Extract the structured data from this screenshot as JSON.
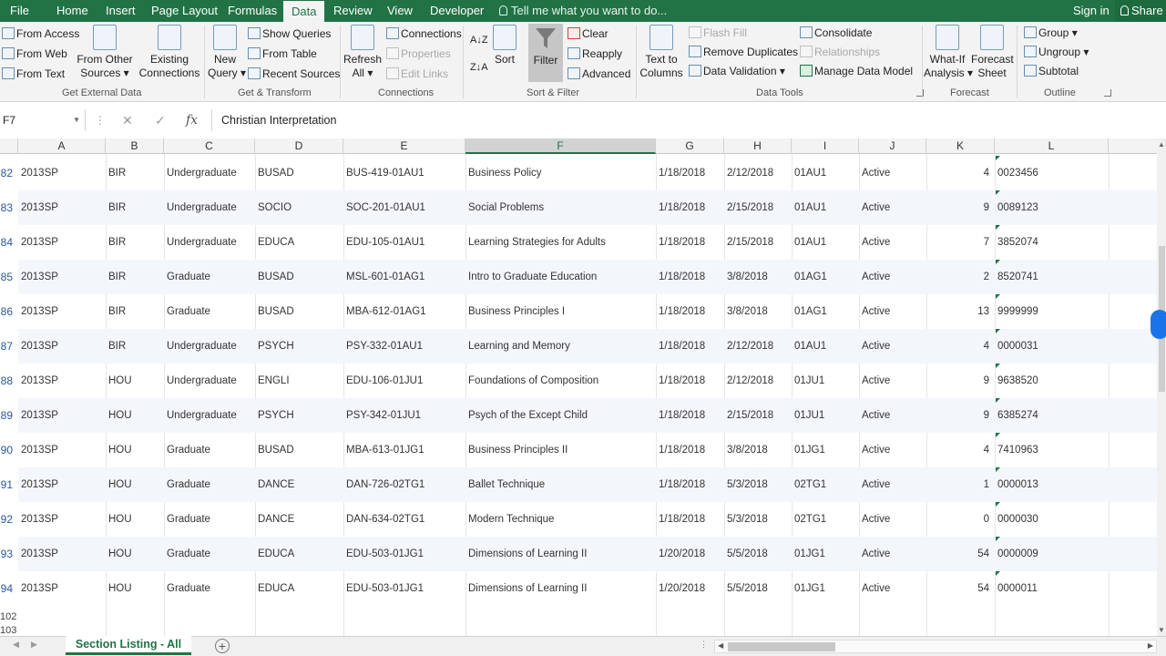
{
  "tabs": [
    {
      "label": "File"
    },
    {
      "label": "Home"
    },
    {
      "label": "Insert"
    },
    {
      "label": "Page Layout"
    },
    {
      "label": "Formulas"
    },
    {
      "label": "Data"
    },
    {
      "label": "Review"
    },
    {
      "label": "View"
    },
    {
      "label": "Developer"
    }
  ],
  "active_tab": "Data",
  "tell_me": "Tell me what you want to do...",
  "sign_in": "Sign in",
  "share": "Share",
  "ribbon": {
    "get_external": {
      "from_access": "From Access",
      "from_web": "From Web",
      "from_text": "From Text",
      "from_other_1": "From Other",
      "from_other_2": "Sources",
      "existing_1": "Existing",
      "existing_2": "Connections",
      "label": "Get External Data"
    },
    "get_transform": {
      "new_query_1": "New",
      "new_query_2": "Query",
      "show_queries": "Show Queries",
      "from_table": "From Table",
      "recent_sources": "Recent Sources",
      "label": "Get & Transform"
    },
    "connections": {
      "refresh_1": "Refresh",
      "refresh_2": "All",
      "connections": "Connections",
      "properties": "Properties",
      "edit_links": "Edit Links",
      "label": "Connections"
    },
    "sort_filter": {
      "sort": "Sort",
      "filter": "Filter",
      "clear": "Clear",
      "reapply": "Reapply",
      "advanced": "Advanced",
      "label": "Sort & Filter"
    },
    "data_tools": {
      "text_to_1": "Text to",
      "text_to_2": "Columns",
      "flash_fill": "Flash Fill",
      "remove_duplicates": "Remove Duplicates",
      "data_validation": "Data Validation",
      "consolidate": "Consolidate",
      "relationships": "Relationships",
      "manage_data_model": "Manage Data Model",
      "label": "Data Tools"
    },
    "forecast": {
      "what_if_1": "What-If",
      "what_if_2": "Analysis",
      "forecast_1": "Forecast",
      "forecast_2": "Sheet",
      "label": "Forecast"
    },
    "outline": {
      "group": "Group",
      "ungroup": "Ungroup",
      "subtotal": "Subtotal",
      "label": "Outline"
    }
  },
  "name_box": "F7",
  "formula": "Christian Interpretation",
  "columns": [
    "A",
    "B",
    "C",
    "D",
    "E",
    "F",
    "G",
    "H",
    "I",
    "J",
    "K",
    "L"
  ],
  "selected_column": "F",
  "rows": [
    {
      "n": "82",
      "a": "2013SP",
      "b": "BIR",
      "c": "Undergraduate",
      "d": "BUSAD",
      "e": "BUS-419-01AU1",
      "f": "Business Policy",
      "g": "1/18/2018",
      "h": "2/12/2018",
      "i": "01AU1",
      "j": "Active",
      "k": "4",
      "l": "0023456"
    },
    {
      "n": "83",
      "a": "2013SP",
      "b": "BIR",
      "c": "Undergraduate",
      "d": "SOCIO",
      "e": "SOC-201-01AU1",
      "f": "Social Problems",
      "g": "1/18/2018",
      "h": "2/15/2018",
      "i": "01AU1",
      "j": "Active",
      "k": "9",
      "l": "0089123"
    },
    {
      "n": "84",
      "a": "2013SP",
      "b": "BIR",
      "c": "Undergraduate",
      "d": "EDUCA",
      "e": "EDU-105-01AU1",
      "f": "Learning Strategies for Adults",
      "g": "1/18/2018",
      "h": "2/15/2018",
      "i": "01AU1",
      "j": "Active",
      "k": "7",
      "l": "3852074"
    },
    {
      "n": "85",
      "a": "2013SP",
      "b": "BIR",
      "c": "Graduate",
      "d": "BUSAD",
      "e": "MSL-601-01AG1",
      "f": "Intro to Graduate Education",
      "g": "1/18/2018",
      "h": "3/8/2018",
      "i": "01AG1",
      "j": "Active",
      "k": "2",
      "l": "8520741"
    },
    {
      "n": "86",
      "a": "2013SP",
      "b": "BIR",
      "c": "Graduate",
      "d": "BUSAD",
      "e": "MBA-612-01AG1",
      "f": "Business Principles I",
      "g": "1/18/2018",
      "h": "3/8/2018",
      "i": "01AG1",
      "j": "Active",
      "k": "13",
      "l": "9999999"
    },
    {
      "n": "87",
      "a": "2013SP",
      "b": "BIR",
      "c": "Undergraduate",
      "d": "PSYCH",
      "e": "PSY-332-01AU1",
      "f": "Learning and Memory",
      "g": "1/18/2018",
      "h": "2/12/2018",
      "i": "01AU1",
      "j": "Active",
      "k": "4",
      "l": "0000031"
    },
    {
      "n": "88",
      "a": "2013SP",
      "b": "HOU",
      "c": "Undergraduate",
      "d": "ENGLI",
      "e": "EDU-106-01JU1",
      "f": "Foundations of Composition",
      "g": "1/18/2018",
      "h": "2/12/2018",
      "i": "01JU1",
      "j": "Active",
      "k": "9",
      "l": "9638520"
    },
    {
      "n": "89",
      "a": "2013SP",
      "b": "HOU",
      "c": "Undergraduate",
      "d": "PSYCH",
      "e": "PSY-342-01JU1",
      "f": "Psych of the Except Child",
      "g": "1/18/2018",
      "h": "2/15/2018",
      "i": "01JU1",
      "j": "Active",
      "k": "9",
      "l": "6385274"
    },
    {
      "n": "90",
      "a": "2013SP",
      "b": "HOU",
      "c": "Graduate",
      "d": "BUSAD",
      "e": "MBA-613-01JG1",
      "f": "Business Principles II",
      "g": "1/18/2018",
      "h": "3/8/2018",
      "i": "01JG1",
      "j": "Active",
      "k": "4",
      "l": "7410963"
    },
    {
      "n": "91",
      "a": "2013SP",
      "b": "HOU",
      "c": "Graduate",
      "d": "DANCE",
      "e": "DAN-726-02TG1",
      "f": "Ballet Technique",
      "g": "1/18/2018",
      "h": "5/3/2018",
      "i": "02TG1",
      "j": "Active",
      "k": "1",
      "l": "0000013"
    },
    {
      "n": "92",
      "a": "2013SP",
      "b": "HOU",
      "c": "Graduate",
      "d": "DANCE",
      "e": "DAN-634-02TG1",
      "f": "Modern Technique",
      "g": "1/18/2018",
      "h": "5/3/2018",
      "i": "02TG1",
      "j": "Active",
      "k": "0",
      "l": "0000030"
    },
    {
      "n": "93",
      "a": "2013SP",
      "b": "HOU",
      "c": "Graduate",
      "d": "EDUCA",
      "e": "EDU-503-01JG1",
      "f": "Dimensions of Learning II",
      "g": "1/20/2018",
      "h": "5/5/2018",
      "i": "01JG1",
      "j": "Active",
      "k": "54",
      "l": "0000009"
    },
    {
      "n": "94",
      "a": "2013SP",
      "b": "HOU",
      "c": "Graduate",
      "d": "EDUCA",
      "e": "EDU-503-01JG1",
      "f": "Dimensions of Learning II",
      "g": "1/20/2018",
      "h": "5/5/2018",
      "i": "01JG1",
      "j": "Active",
      "k": "54",
      "l": "0000011"
    }
  ],
  "trailing_rows": [
    "102",
    "103"
  ],
  "sheet_tab": "Section Listing - All",
  "colors": {
    "accent": "#217346",
    "row_number": "#2b5797"
  },
  "icons": [
    "lightbulb-icon",
    "user-icon",
    "function-icon",
    "filter-funnel-icon",
    "dropbox-icon"
  ]
}
